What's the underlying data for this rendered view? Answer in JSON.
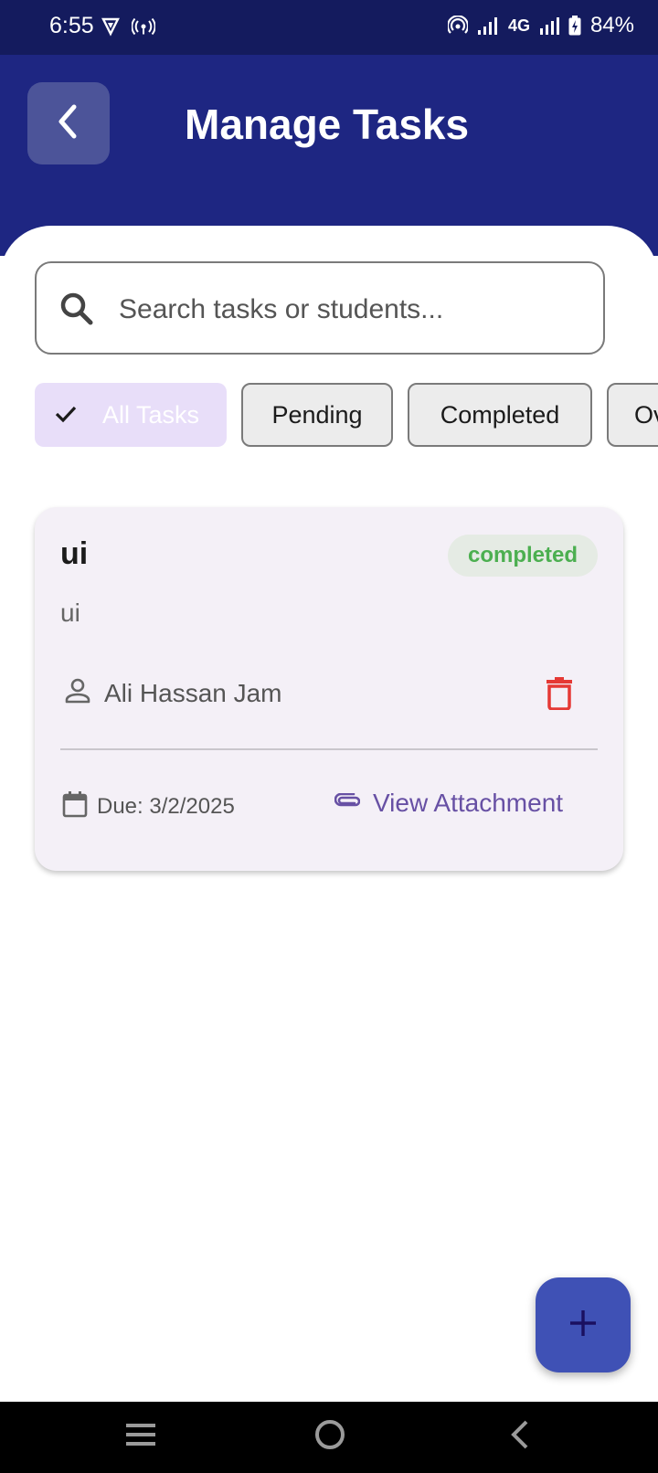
{
  "status_bar": {
    "time": "6:55",
    "network": "4G",
    "battery": "84%"
  },
  "header": {
    "title": "Manage Tasks"
  },
  "search": {
    "placeholder": "Search tasks or students..."
  },
  "filters": [
    {
      "label": "All Tasks",
      "selected": true
    },
    {
      "label": "Pending",
      "selected": false
    },
    {
      "label": "Completed",
      "selected": false
    },
    {
      "label": "Ov",
      "selected": false
    }
  ],
  "tasks": [
    {
      "title": "ui",
      "status": "completed",
      "description": "ui",
      "student": "Ali Hassan Jam",
      "due": "Due: 3/2/2025",
      "attachment_label": "View Attachment"
    }
  ],
  "colors": {
    "status_bar": "#141b5e",
    "header": "#1e2682",
    "accent_purple": "#6750a4",
    "completed_green": "#4caf50",
    "delete_red": "#e53935",
    "fab": "#3f51b5"
  },
  "icons": [
    "back-icon",
    "search-icon",
    "check-icon",
    "person-icon",
    "delete-icon",
    "calendar-icon",
    "attachment-icon",
    "plus-icon"
  ]
}
